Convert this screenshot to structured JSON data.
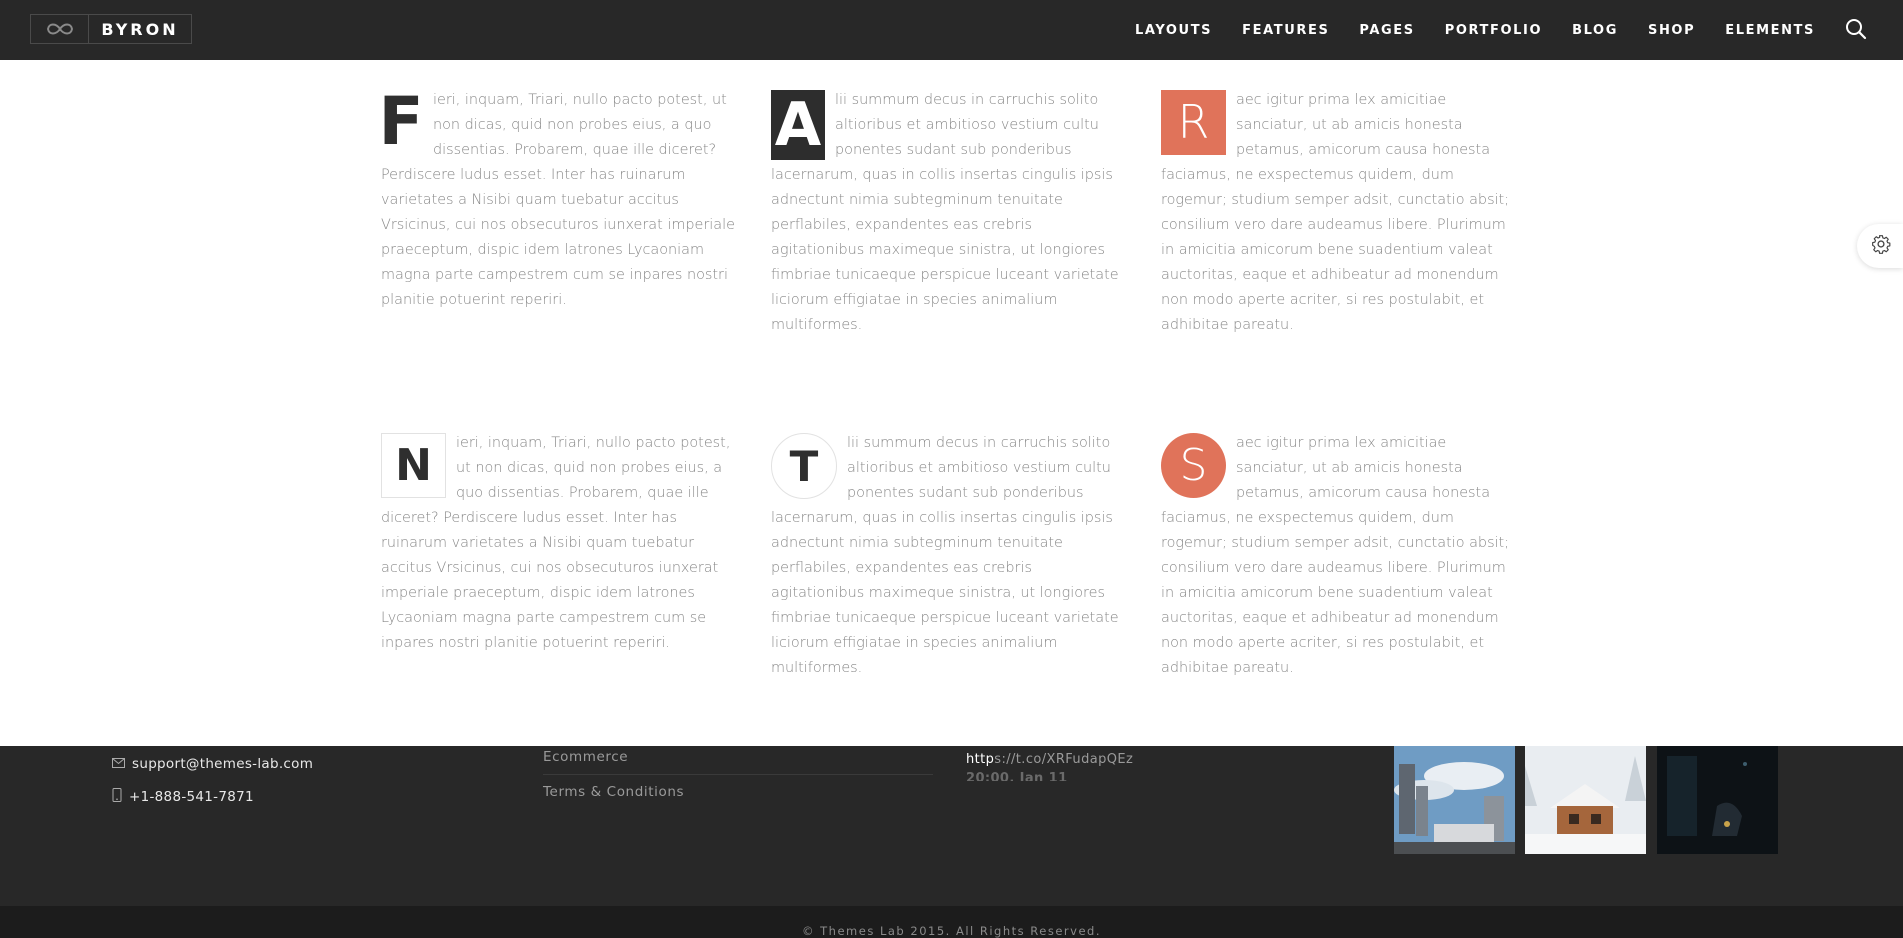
{
  "brand": {
    "name": "BYRON",
    "logo_icon": "infinity-icon"
  },
  "nav": {
    "items": [
      "LAYOUTS",
      "FEATURES",
      "PAGES",
      "PORTFOLIO",
      "BLOG",
      "SHOP",
      "ELEMENTS"
    ],
    "search_icon": "search-icon"
  },
  "dropcaps": [
    {
      "letter": "F",
      "style": "plain",
      "text": "ieri, inquam, Triari, nullo pacto potest, ut non dicas, quid non probes eius, a quo dissentias. Probarem, quae ille diceret? Perdiscere ludus esset. Inter has ruinarum varietates a Nisibi quam tuebatur accitus Vrsicinus, cui nos obsecuturos iunxerat imperiale praeceptum, dispic idem latrones Lycaoniam magna parte campestrem cum se inpares nostri planitie potuerint reperiri."
    },
    {
      "letter": "A",
      "style": "dark-square",
      "text": "lii summum decus in carruchis solito altioribus et ambitioso vestium cultu ponentes sudant sub ponderibus lacernarum, quas in collis insertas cingulis ipsis adnectunt nimia subtegminum tenuitate perflabiles, expandentes eas crebris agitationibus maximeque sinistra, ut longiores fimbriae tunicaeque perspicue luceant varietate liciorum effigiatae in species animalium multiformes."
    },
    {
      "letter": "R",
      "style": "orange-square",
      "text": "aec igitur prima lex amicitiae sanciatur, ut ab amicis honesta petamus, amicorum causa honesta faciamus, ne exspectemus quidem, dum rogemur; studium semper adsit, cunctatio absit; consilium vero dare audeamus libere. Plurimum in amicitia amicorum bene suadentium valeat auctoritas, eaque et adhibeatur ad monendum non modo aperte acriter, si res postulabit, et adhibitae pareatu."
    },
    {
      "letter": "N",
      "style": "bordered-square",
      "text": "ieri, inquam, Triari, nullo pacto potest, ut non dicas, quid non probes eius, a quo dissentias. Probarem, quae ille diceret? Perdiscere ludus esset. Inter has ruinarum varietates a Nisibi quam tuebatur accitus Vrsicinus, cui nos obsecuturos iunxerat imperiale praeceptum, dispic idem latrones Lycaoniam magna parte campestrem cum se inpares nostri planitie potuerint reperiri."
    },
    {
      "letter": "T",
      "style": "outlined-circle",
      "text": "lii summum decus in carruchis solito altioribus et ambitioso vestium cultu ponentes sudant sub ponderibus lacernarum, quas in collis insertas cingulis ipsis adnectunt nimia subtegminum tenuitate perflabiles, expandentes eas crebris agitationibus maximeque sinistra, ut longiores fimbriae tunicaeque perspicue luceant varietate liciorum effigiatae in species animalium multiformes."
    },
    {
      "letter": "S",
      "style": "orange-circle",
      "text": "aec igitur prima lex amicitiae sanciatur, ut ab amicis honesta petamus, amicorum causa honesta faciamus, ne exspectemus quidem, dum rogemur; studium semper adsit, cunctatio absit; consilium vero dare audeamus libere. Plurimum in amicitia amicorum bene suadentium valeat auctoritas, eaque et adhibeatur ad monendum non modo aperte acriter, si res postulabit, et adhibitae pareatu."
    }
  ],
  "settings": {
    "icon": "gear-icon"
  },
  "footer": {
    "contact": {
      "email": "support@themes-lab.com",
      "email_icon": "envelope-icon",
      "phone": "+1-888-541-7871",
      "phone_icon": "mobile-phone-icon"
    },
    "links": [
      "Ecommerce",
      "Terms & Conditions"
    ],
    "tweet": {
      "link_prefix": "http",
      "link_rest": "s://t.co/XRFudapQEz",
      "time": "20:00, Jan 11"
    },
    "gallery": [
      "city-street-photo",
      "snowy-cabin-photo",
      "dark-night-photo"
    ],
    "copyright": "© Themes Lab 2015. All Rights Reserved."
  },
  "colors": {
    "accent": "#e0735a",
    "dark": "#282828",
    "body_text": "#888888"
  }
}
